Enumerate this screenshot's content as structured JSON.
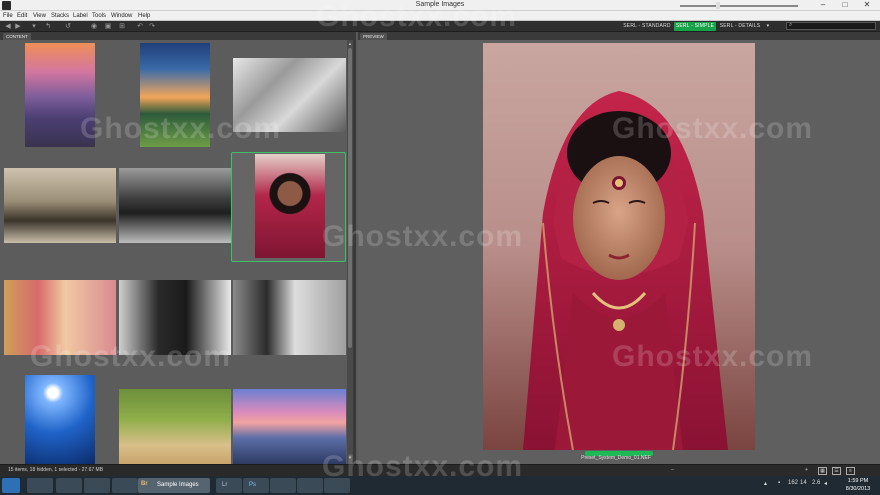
{
  "window": {
    "title": "Sample Images",
    "minimize": "–",
    "maximize": "□",
    "close": "✕"
  },
  "menu": [
    "File",
    "Edit",
    "View",
    "Stacks",
    "Label",
    "Tools",
    "Window",
    "Help"
  ],
  "workspaces": {
    "standard": "SERL - STANDARD",
    "simple": "SERL - SIMPLE",
    "details": "SERL - DETAILS",
    "more": "▾"
  },
  "panels": {
    "content_tab": "CONTENT",
    "preview_tab": "PREVIEW"
  },
  "preview": {
    "filename": "Preset_System_Demo_01.NEF"
  },
  "status": {
    "summary": "15 items, 18 hidden, 1 selected - 27.67 MB",
    "zoom_fraction": 0.32
  },
  "taskbar": {
    "bridge_label": "Sample Images",
    "apps": [
      "Br",
      "Lr",
      "Ps"
    ],
    "time": "1:59 PM",
    "date": "8/30/2013",
    "tray_values": [
      "162",
      "14",
      "2.6"
    ]
  },
  "watermark": "Ghostxx.com",
  "icons": [
    "search-icon",
    "back-icon",
    "forward-icon",
    "camera-icon",
    "rotate-left-icon",
    "rotate-right-icon",
    "refine-icon",
    "grid-icon",
    "list-icon",
    "start-icon"
  ]
}
